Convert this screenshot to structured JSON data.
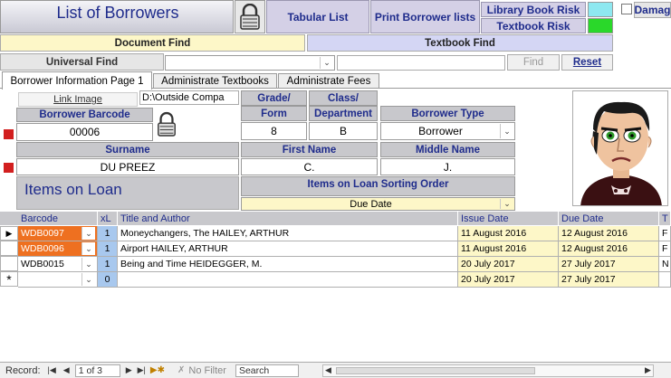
{
  "header": {
    "title": "List of Borrowers",
    "tabular_list": "Tabular List",
    "print_lists": "Print Borrower lists",
    "library_book_risk": "Library Book Risk",
    "textbook_risk": "Textbook Risk",
    "damage_label": "Damag",
    "document_find": "Document Find",
    "textbook_find": "Textbook Find",
    "universal_find": "Universal Find",
    "find": "Find",
    "reset": "Reset"
  },
  "tabs": [
    "Borrower Information Page 1",
    "Administrate Textbooks",
    "Administrate Fees"
  ],
  "form": {
    "link_image_label": "Link Image",
    "link_image_value": "D:\\Outside Compa",
    "barcode_label": "Borrower Barcode",
    "barcode_value": "00006",
    "grade_label_1": "Grade/",
    "grade_label_2": "Form",
    "grade_value": "8",
    "class_label_1": "Class/",
    "class_label_2": "Department",
    "class_value": "B",
    "type_label": "Borrower Type",
    "type_value": "Borrower",
    "surname_label": "Surname",
    "surname_value": "DU PREEZ",
    "first_name_label": "First Name",
    "first_name_value": "C.",
    "middle_name_label": "Middle Name",
    "middle_name_value": "J.",
    "items_on_loan": "Items on Loan",
    "sort_order_label": "Items on Loan Sorting Order",
    "sort_order_value": "Due Date"
  },
  "table": {
    "columns": [
      "Barcode",
      "xL",
      "Title and Author",
      "Issue Date",
      "Due Date",
      "T"
    ],
    "rows": [
      {
        "barcode": "WDB0097",
        "xl": "1",
        "title": "Moneychangers, The    HAILEY, ARTHUR",
        "issue": "11 August 2016",
        "due": "12 August 2016",
        "t": "F"
      },
      {
        "barcode": "WDB0096",
        "xl": "1",
        "title": "Airport    HAILEY, ARTHUR",
        "issue": "11 August 2016",
        "due": "12 August 2016",
        "t": "F"
      },
      {
        "barcode": "WDB0015",
        "xl": "1",
        "title": "Being and Time    HEIDEGGER, M.",
        "issue": "20 July 2017",
        "due": "27 July 2017",
        "t": "N"
      },
      {
        "barcode": "",
        "xl": "0",
        "title": "",
        "issue": "20 July 2017",
        "due": "27 July 2017",
        "t": ""
      }
    ]
  },
  "nav": {
    "record_label": "Record:",
    "record_value": "1 of 3",
    "no_filter": "No Filter",
    "search_placeholder": "Search"
  },
  "colors": {
    "risk_cyan": "#8ee8f0",
    "risk_green": "#2ad82a",
    "orange": "#ee7020",
    "required": "#d21f1f"
  }
}
